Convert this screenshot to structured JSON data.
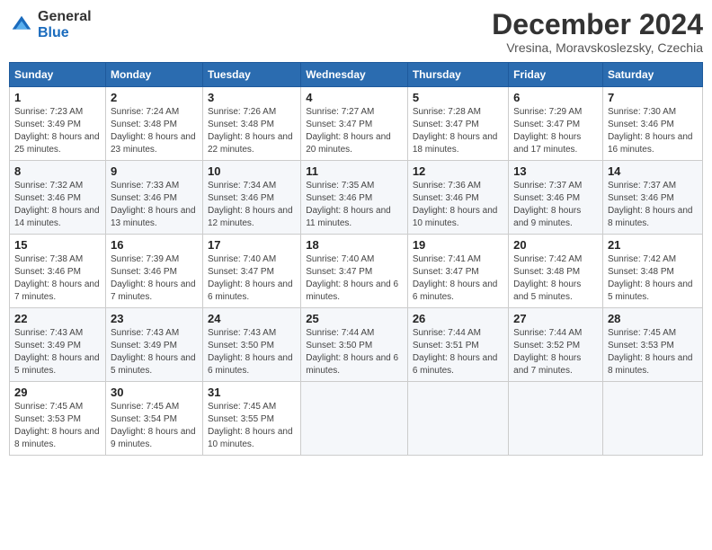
{
  "logo": {
    "general": "General",
    "blue": "Blue"
  },
  "title": "December 2024",
  "subtitle": "Vresina, Moravskoslezsky, Czechia",
  "calendar": {
    "headers": [
      "Sunday",
      "Monday",
      "Tuesday",
      "Wednesday",
      "Thursday",
      "Friday",
      "Saturday"
    ],
    "weeks": [
      [
        {
          "day": "1",
          "info": "Sunrise: 7:23 AM\nSunset: 3:49 PM\nDaylight: 8 hours and 25 minutes."
        },
        {
          "day": "2",
          "info": "Sunrise: 7:24 AM\nSunset: 3:48 PM\nDaylight: 8 hours and 23 minutes."
        },
        {
          "day": "3",
          "info": "Sunrise: 7:26 AM\nSunset: 3:48 PM\nDaylight: 8 hours and 22 minutes."
        },
        {
          "day": "4",
          "info": "Sunrise: 7:27 AM\nSunset: 3:47 PM\nDaylight: 8 hours and 20 minutes."
        },
        {
          "day": "5",
          "info": "Sunrise: 7:28 AM\nSunset: 3:47 PM\nDaylight: 8 hours and 18 minutes."
        },
        {
          "day": "6",
          "info": "Sunrise: 7:29 AM\nSunset: 3:47 PM\nDaylight: 8 hours and 17 minutes."
        },
        {
          "day": "7",
          "info": "Sunrise: 7:30 AM\nSunset: 3:46 PM\nDaylight: 8 hours and 16 minutes."
        }
      ],
      [
        {
          "day": "8",
          "info": "Sunrise: 7:32 AM\nSunset: 3:46 PM\nDaylight: 8 hours and 14 minutes."
        },
        {
          "day": "9",
          "info": "Sunrise: 7:33 AM\nSunset: 3:46 PM\nDaylight: 8 hours and 13 minutes."
        },
        {
          "day": "10",
          "info": "Sunrise: 7:34 AM\nSunset: 3:46 PM\nDaylight: 8 hours and 12 minutes."
        },
        {
          "day": "11",
          "info": "Sunrise: 7:35 AM\nSunset: 3:46 PM\nDaylight: 8 hours and 11 minutes."
        },
        {
          "day": "12",
          "info": "Sunrise: 7:36 AM\nSunset: 3:46 PM\nDaylight: 8 hours and 10 minutes."
        },
        {
          "day": "13",
          "info": "Sunrise: 7:37 AM\nSunset: 3:46 PM\nDaylight: 8 hours and 9 minutes."
        },
        {
          "day": "14",
          "info": "Sunrise: 7:37 AM\nSunset: 3:46 PM\nDaylight: 8 hours and 8 minutes."
        }
      ],
      [
        {
          "day": "15",
          "info": "Sunrise: 7:38 AM\nSunset: 3:46 PM\nDaylight: 8 hours and 7 minutes."
        },
        {
          "day": "16",
          "info": "Sunrise: 7:39 AM\nSunset: 3:46 PM\nDaylight: 8 hours and 7 minutes."
        },
        {
          "day": "17",
          "info": "Sunrise: 7:40 AM\nSunset: 3:47 PM\nDaylight: 8 hours and 6 minutes."
        },
        {
          "day": "18",
          "info": "Sunrise: 7:40 AM\nSunset: 3:47 PM\nDaylight: 8 hours and 6 minutes."
        },
        {
          "day": "19",
          "info": "Sunrise: 7:41 AM\nSunset: 3:47 PM\nDaylight: 8 hours and 6 minutes."
        },
        {
          "day": "20",
          "info": "Sunrise: 7:42 AM\nSunset: 3:48 PM\nDaylight: 8 hours and 5 minutes."
        },
        {
          "day": "21",
          "info": "Sunrise: 7:42 AM\nSunset: 3:48 PM\nDaylight: 8 hours and 5 minutes."
        }
      ],
      [
        {
          "day": "22",
          "info": "Sunrise: 7:43 AM\nSunset: 3:49 PM\nDaylight: 8 hours and 5 minutes."
        },
        {
          "day": "23",
          "info": "Sunrise: 7:43 AM\nSunset: 3:49 PM\nDaylight: 8 hours and 5 minutes."
        },
        {
          "day": "24",
          "info": "Sunrise: 7:43 AM\nSunset: 3:50 PM\nDaylight: 8 hours and 6 minutes."
        },
        {
          "day": "25",
          "info": "Sunrise: 7:44 AM\nSunset: 3:50 PM\nDaylight: 8 hours and 6 minutes."
        },
        {
          "day": "26",
          "info": "Sunrise: 7:44 AM\nSunset: 3:51 PM\nDaylight: 8 hours and 6 minutes."
        },
        {
          "day": "27",
          "info": "Sunrise: 7:44 AM\nSunset: 3:52 PM\nDaylight: 8 hours and 7 minutes."
        },
        {
          "day": "28",
          "info": "Sunrise: 7:45 AM\nSunset: 3:53 PM\nDaylight: 8 hours and 8 minutes."
        }
      ],
      [
        {
          "day": "29",
          "info": "Sunrise: 7:45 AM\nSunset: 3:53 PM\nDaylight: 8 hours and 8 minutes."
        },
        {
          "day": "30",
          "info": "Sunrise: 7:45 AM\nSunset: 3:54 PM\nDaylight: 8 hours and 9 minutes."
        },
        {
          "day": "31",
          "info": "Sunrise: 7:45 AM\nSunset: 3:55 PM\nDaylight: 8 hours and 10 minutes."
        },
        null,
        null,
        null,
        null
      ]
    ]
  }
}
